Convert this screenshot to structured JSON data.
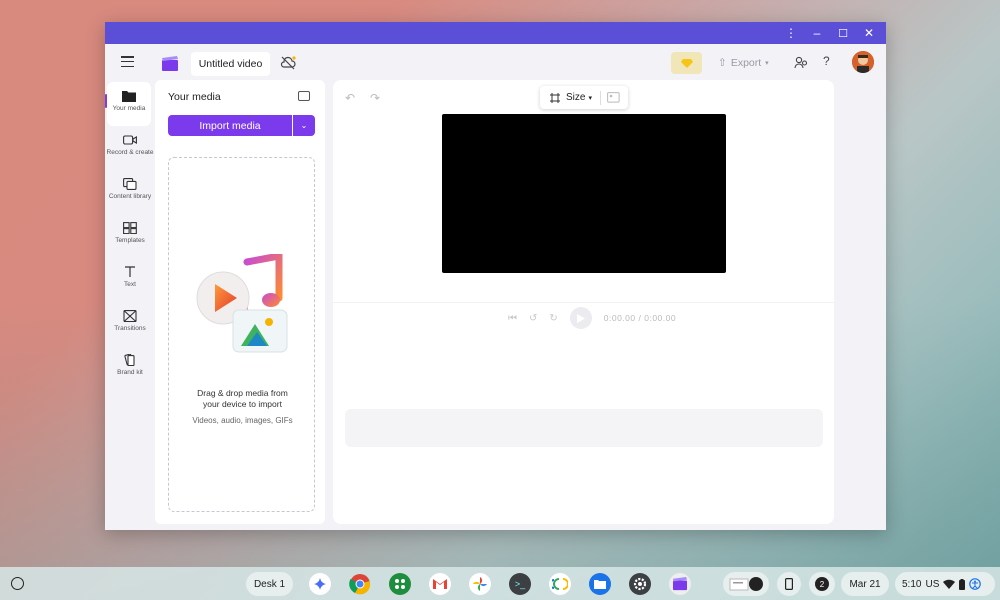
{
  "app": {
    "title": "Untitled video",
    "accent": "#7c3aed",
    "titlebar_color": "#5b4fd8"
  },
  "window_controls": {
    "menu": "⋮",
    "minimize": "–",
    "maximize": "☐",
    "close": "✕"
  },
  "toolbar": {
    "export_label": "Export"
  },
  "rail": [
    {
      "label": "Your media",
      "icon": "folder-icon"
    },
    {
      "label": "Record & create",
      "icon": "camera-icon"
    },
    {
      "label": "Content library",
      "icon": "library-icon"
    },
    {
      "label": "Templates",
      "icon": "templates-icon"
    },
    {
      "label": "Text",
      "icon": "text-icon"
    },
    {
      "label": "Transitions",
      "icon": "transitions-icon"
    },
    {
      "label": "Brand kit",
      "icon": "brand-kit-icon"
    }
  ],
  "media_panel": {
    "title": "Your media",
    "import_label": "Import media",
    "drop_line1": "Drag & drop media from",
    "drop_line2": "your device to import",
    "drop_types": "Videos, audio, images, GIFs"
  },
  "preview": {
    "size_label": "Size",
    "time": "0:00.00 / 0:00.00"
  },
  "shelf": {
    "desk": "Desk 1",
    "notifications": "2",
    "date": "Mar 21",
    "time": "5:10",
    "locale": "US"
  }
}
